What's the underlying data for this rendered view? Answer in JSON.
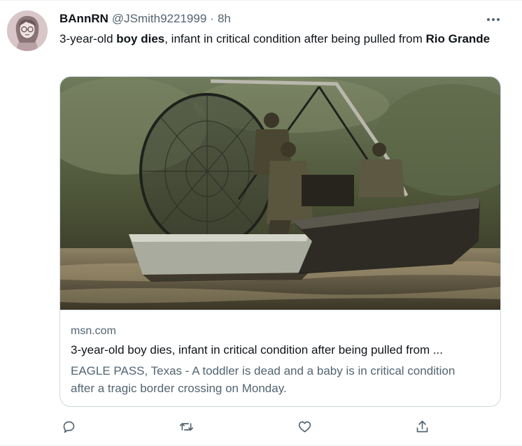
{
  "tweet": {
    "author_name": "BAnnRN",
    "handle": "@JSmith9221999",
    "separator": "·",
    "time": "8h",
    "text": {
      "part1": "3-year-old ",
      "bold1": "boy dies",
      "part2": ", infant in critical condition after being pulled from ",
      "bold2": "Rio Grande"
    }
  },
  "card": {
    "domain": "msn.com",
    "title": "3-year-old boy dies, infant in critical condition after being pulled from ...",
    "description": "EAGLE PASS, Texas - A toddler is dead and a baby is in critical condition after a tragic border crossing on Monday."
  },
  "icons": {
    "more": "more-options-icon",
    "reply": "reply-icon",
    "retweet": "retweet-icon",
    "like": "like-icon",
    "share": "share-icon"
  },
  "colors": {
    "text_primary": "#0f1419",
    "text_secondary": "#536471",
    "border": "#cfd9de"
  }
}
